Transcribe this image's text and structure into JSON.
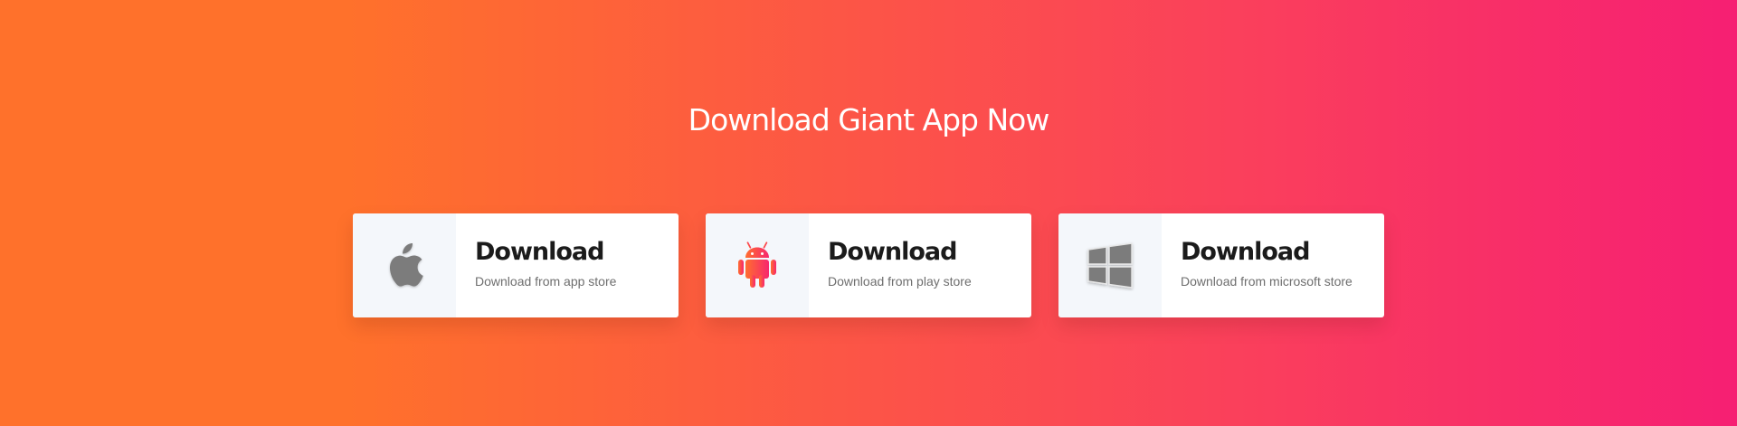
{
  "heading": "Download Giant App Now",
  "cards": [
    {
      "icon": "apple-icon",
      "title": "Download",
      "subtitle": "Download from app store"
    },
    {
      "icon": "android-icon",
      "title": "Download",
      "subtitle": "Download from play store"
    },
    {
      "icon": "windows-icon",
      "title": "Download",
      "subtitle": "Download from microsoft store"
    }
  ],
  "colors": {
    "gradient_start": "#ff712b",
    "gradient_end": "#f61f73",
    "card_background": "#ffffff",
    "icon_panel_background": "#f4f7fb",
    "title_text": "#1b1b1b",
    "subtitle_text": "#6e6e6e",
    "apple_icon": "#7c7c7c",
    "windows_icon": "#7c7c7c"
  }
}
